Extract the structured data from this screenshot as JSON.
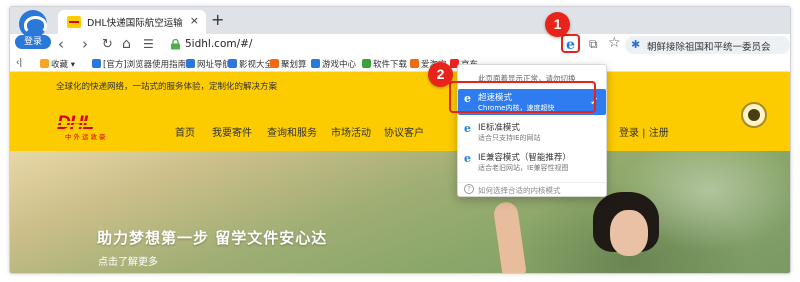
{
  "browser": {
    "login_label": "登录",
    "tab": {
      "title": "DHL快递国际航空运输服务—中",
      "close": "×"
    },
    "new_tab": "+",
    "nav": {
      "back": "‹",
      "forward": "›",
      "reload": "↻",
      "home": "⌂",
      "readmode": "☰"
    },
    "url": "5idhl.com/#/",
    "star": "☆",
    "search_text": "朝鲜接除祖国和平统一委员会"
  },
  "bookmarks": [
    {
      "label": "收藏",
      "color": "#f5a623"
    },
    {
      "label": "[官方]浏览器使用指南",
      "color": "#2a78d8"
    },
    {
      "label": "网址导航",
      "color": "#2a78d8"
    },
    {
      "label": "影视大全",
      "color": "#2a78d8"
    },
    {
      "label": "聚划算",
      "color": "#f26a10"
    },
    {
      "label": "游戏中心",
      "color": "#2a78d8"
    },
    {
      "label": "软件下载",
      "color": "#3aa23a"
    },
    {
      "label": "爱淘宝",
      "color": "#f26a10"
    },
    {
      "label": "京东",
      "color": "#e22"
    }
  ],
  "site": {
    "slogan": "全球化的快递网络，一站式的服务体验，定制化的解决方案",
    "logo_text": "DHL",
    "logo_cn": "中外运敦豪",
    "nav": [
      "首页",
      "我要寄件",
      "查询和服务",
      "市场活动",
      "协议客户"
    ],
    "login": "登录 | 注册",
    "hero_title": "助力梦想第一步  留学文件安心达",
    "hero_more": "点击了解更多"
  },
  "menu": {
    "notice": "此页面着显示正常，请勿切换",
    "items": [
      {
        "title": "超速模式",
        "sub": "Chrome内核，速度超快",
        "selected": true
      },
      {
        "title": "IE标准模式",
        "sub": "适合只支持IE的网站",
        "selected": false
      },
      {
        "title": "IE兼容模式（智能推荐）",
        "sub": "适合老旧网站，IE兼容性视图",
        "selected": false
      }
    ],
    "help": "如何选择合适的内核模式"
  },
  "annotations": {
    "badge1": "1",
    "badge2": "2"
  }
}
